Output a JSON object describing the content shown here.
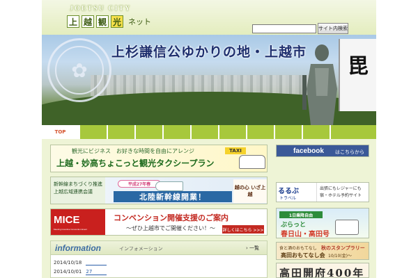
{
  "header": {
    "logo_subtitle": "JOETSU CITY",
    "logo_chars": [
      "上",
      "越",
      "観",
      "光"
    ],
    "logo_suffix": "ネット",
    "search": {
      "placeholder": "",
      "button_label": "サイト内検索"
    }
  },
  "hero": {
    "title": "上杉謙信公ゆかりの地・上越市",
    "flag_char": "毘"
  },
  "nav": {
    "tabs": [
      "TOP",
      "",
      "",
      "",
      "",
      "",
      "",
      "",
      "",
      ""
    ]
  },
  "ads": {
    "taxi": {
      "line1": "観光にビジネス　お好きな時間を自由にアレンジ",
      "line2": "上越・妙高ちょこっと観光タクシープラン",
      "badge": "TAXI"
    },
    "shinkansen": {
      "left_line1": "新幹線まちづくり推進",
      "left_line2": "上越広域連携会議",
      "spring": "平成27年春",
      "main": "北陸新幹線開業！",
      "right": "越の心 いざ上越"
    },
    "mice": {
      "logo": "MICE",
      "logo_sub": "Meeting Incentive Convention Event",
      "title": "コンベンション開催支援のご案内",
      "subtitle": "～ぜひ上越市でご開催ください！～",
      "button": "詳しくはこちら >>>"
    }
  },
  "info": {
    "title": "information",
    "subtitle": "インフォメーション",
    "all_link": "一覧",
    "rows": [
      {
        "date": "2014/10/18",
        "text": ""
      },
      {
        "date": "2014/10/01",
        "text": "27"
      }
    ]
  },
  "side": {
    "facebook": {
      "logo": "facebook",
      "note": "はこちらから"
    },
    "rurubu": {
      "logo": "るるぶ",
      "logo_sub": "トラベル",
      "text": "出張にもレジャーにも 宿・ホテル予約サイト"
    },
    "bus": {
      "tag": "1日乗降自由",
      "line1": "ぶらっと",
      "line2": "春日山・高田号"
    },
    "stamp": {
      "line1": "食と酒のおもてなし",
      "line2": "高田おもてなし会",
      "title": "秋のスタンプラリー",
      "dates": "10/10(金)～10/26(日)"
    },
    "kaifu": {
      "text": "高田開府400年"
    }
  }
}
